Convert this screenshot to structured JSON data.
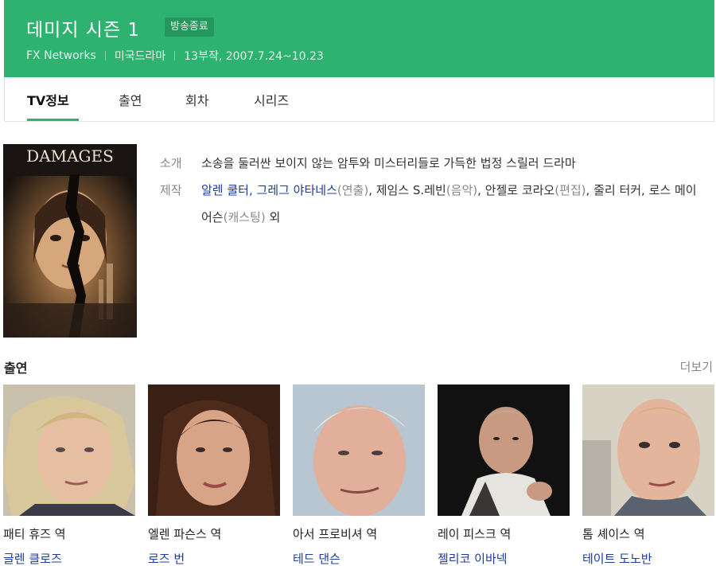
{
  "header": {
    "title": "데미지 시즌 1",
    "status_badge": "방송종료",
    "network": "FX Networks",
    "genre": "미국드라마",
    "episodes_dates": "13부작, 2007.7.24~10.23"
  },
  "tabs": [
    {
      "label": "TV정보",
      "active": true
    },
    {
      "label": "출연",
      "active": false
    },
    {
      "label": "회차",
      "active": false
    },
    {
      "label": "시리즈",
      "active": false
    }
  ],
  "poster": {
    "title_text": "DAMAGES"
  },
  "info": {
    "intro_label": "소개",
    "intro_text": "소송을 둘러싼 보이지 않는 암투와 미스터리들로 가득한 법정 스릴러 드라마",
    "production_label": "제작",
    "production": {
      "director_1": "알렌 쿨터",
      "comma_1": ", ",
      "director_2": "그레그 야타네스",
      "director_role": "(연출)",
      "rest_1": ", 제임스 S.레빈",
      "music_role": "(음악)",
      "rest_2": ", 안젤로 코라오",
      "edit_role": "(편집)",
      "rest_3": ", 줄리 터커, 로스 메이어슨",
      "casting_role": "(캐스팅)",
      "rest_4": " 외"
    }
  },
  "cast_section": {
    "title": "출연",
    "more_label": "더보기",
    "members": [
      {
        "role": "패티 휴즈 역",
        "actor": "글렌 클로즈"
      },
      {
        "role": "엘렌 파슨스 역",
        "actor": "로즈 번"
      },
      {
        "role": "아서 프로비셔 역",
        "actor": "테드 댄슨"
      },
      {
        "role": "레이 피스크 역",
        "actor": "젤리코 이바넥"
      },
      {
        "role": "톰 셰이스 역",
        "actor": "테이트 도노반"
      }
    ]
  },
  "colors": {
    "brand_green": "#2db36f",
    "link_blue": "#1f3c9c"
  }
}
